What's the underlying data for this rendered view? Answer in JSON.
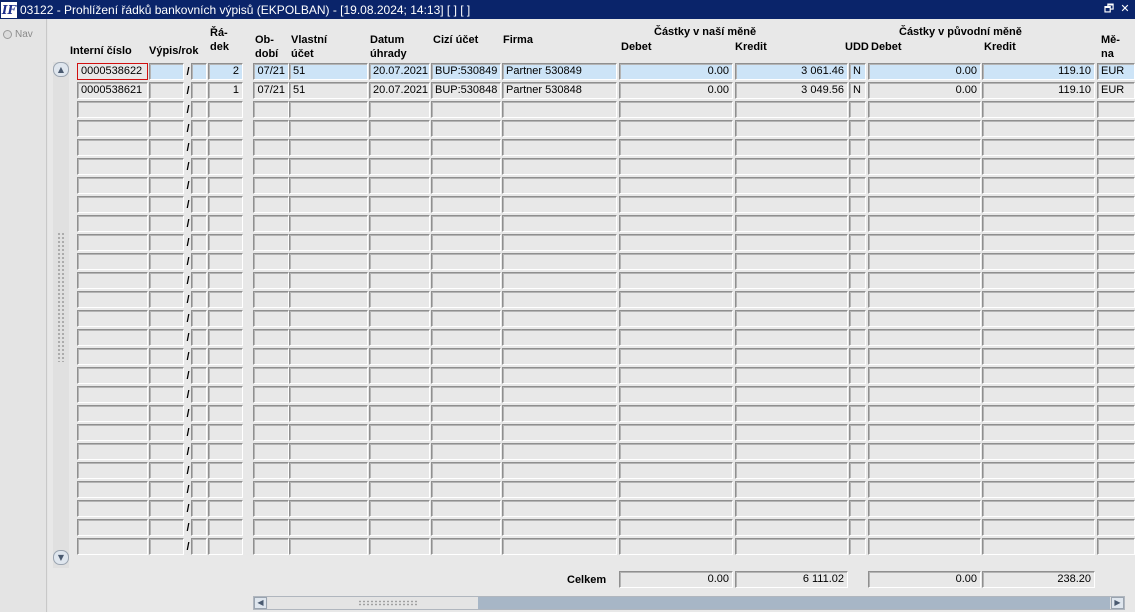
{
  "window": {
    "title": "03122 - Prohlížení řádků bankovních výpisů (EKPOLBAN) - [19.08.2024; 14:13]  [ ]  [ ]",
    "icon_text": "IF",
    "restore_glyph": "🗗",
    "close_glyph": "✕"
  },
  "nav": {
    "label": "Nav"
  },
  "headers": {
    "interni_cislo": "Interní číslo",
    "vypis_rok": "Výpis/rok",
    "radek_1": "Řá-",
    "radek_2": "dek",
    "obdobi_1": "Ob-",
    "obdobi_2": "dobí",
    "vlastni_1": "Vlastní",
    "vlastni_2": "účet",
    "datum_1": "Datum",
    "datum_2": "úhrady",
    "cizi_ucet": "Cizí účet",
    "firma": "Firma",
    "group_nase": "Částky v naší měně",
    "debet": "Debet",
    "kredit": "Kredit",
    "udd": "UDD",
    "group_puvodni": "Částky v původní měně",
    "debet2": "Debet",
    "kredit2": "Kredit",
    "mena_1": "Mě-",
    "mena_2": "na"
  },
  "rows": [
    {
      "interni": "0000538622",
      "vypis": "",
      "rok": "",
      "radek": "2",
      "obdobi": "07/21",
      "vlastni": "51",
      "datum": "20.07.2021",
      "cizi": "BUP:530849",
      "firma": "Partner 530849",
      "debet": "0.00",
      "kredit": "3 061.46",
      "udd": "N",
      "debet2": "0.00",
      "kredit2": "119.10",
      "mena": "EUR"
    },
    {
      "interni": "0000538621",
      "vypis": "",
      "rok": "",
      "radek": "1",
      "obdobi": "07/21",
      "vlastni": "51",
      "datum": "20.07.2021",
      "cizi": "BUP:530848",
      "firma": "Partner 530848",
      "debet": "0.00",
      "kredit": "3 049.56",
      "udd": "N",
      "debet2": "0.00",
      "kredit2": "119.10",
      "mena": "EUR"
    }
  ],
  "empty_rows": 24,
  "slash": "/",
  "totals": {
    "label": "Celkem",
    "debet": "0.00",
    "kredit": "6 111.02",
    "debet2": "0.00",
    "kredit2": "238.20"
  },
  "scroll": {
    "up": "▲",
    "down": "▼",
    "left": "◀",
    "right": "▶"
  }
}
